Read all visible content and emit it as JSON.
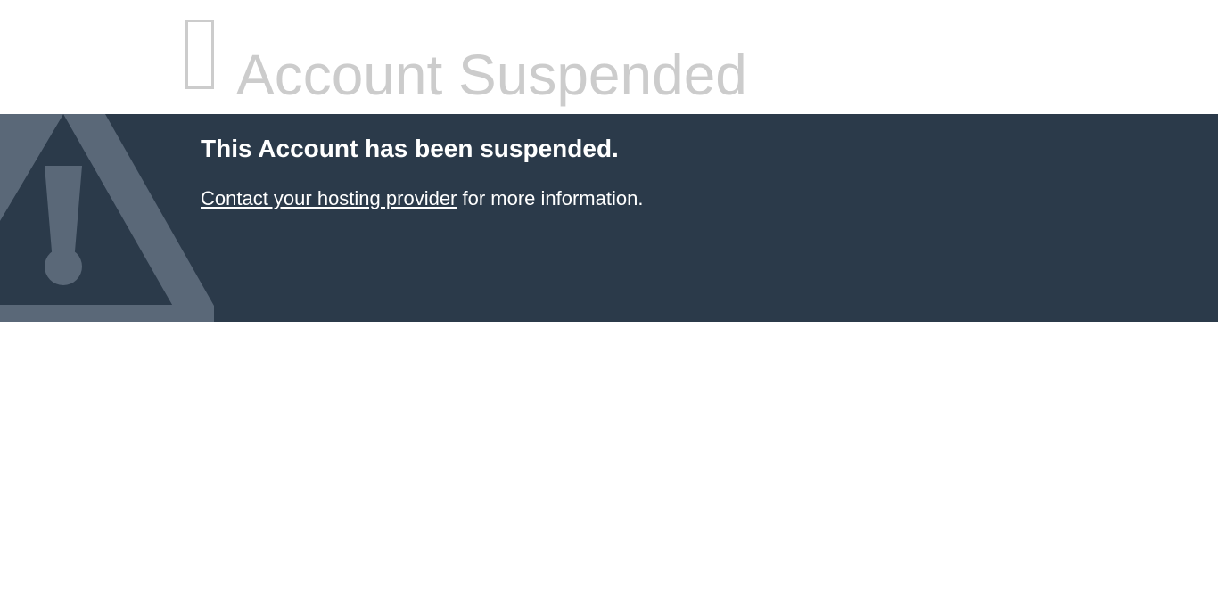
{
  "header": {
    "icon": "glyph-box-icon",
    "title": "Account Suspended",
    "title_color": "#cccccc"
  },
  "banner": {
    "background_color": "#2b3a4a",
    "icon": "warning-triangle-icon",
    "icon_color": "#5a6878",
    "heading": "This Account has been suspended.",
    "contact_link_label": "Contact your hosting provider",
    "info_suffix": " for more information."
  }
}
